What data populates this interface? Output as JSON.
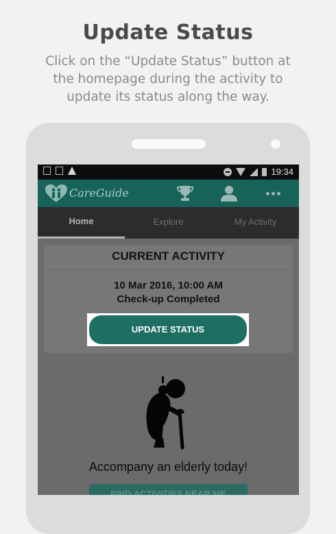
{
  "promo": {
    "title": "Update Status",
    "description_line1": "Click on the “Update Status” button at",
    "description_line2": "the homepage during the activity to",
    "description_line3": "update its status along the way."
  },
  "status_bar": {
    "time": "19:34",
    "icons": [
      "image-icon",
      "download-icon",
      "warning-icon",
      "do-not-disturb-icon",
      "wifi-icon",
      "signal-icon",
      "battery-icon"
    ]
  },
  "app_bar": {
    "logo_text": "CareGuide",
    "icons": [
      "trophy-icon",
      "profile-icon",
      "more-icon"
    ]
  },
  "tabs": [
    {
      "label": "Home",
      "active": true
    },
    {
      "label": "Explore",
      "active": false
    },
    {
      "label": "My Activity",
      "active": false
    }
  ],
  "current_activity": {
    "header": "CURRENT ACTIVITY",
    "datetime": "10 Mar 2016, 10:00 AM",
    "status": "Check-up Completed",
    "button_label": "UPDATE STATUS"
  },
  "empty_state": {
    "tagline": "Accompany an elderly today!",
    "button_label": "FIND ACTIVITIES NEAR ME"
  },
  "colors": {
    "accent": "#17635a",
    "button": "#1f6e63",
    "tab_bar": "#2c2c2c",
    "overlay": "#6b6b6b"
  }
}
